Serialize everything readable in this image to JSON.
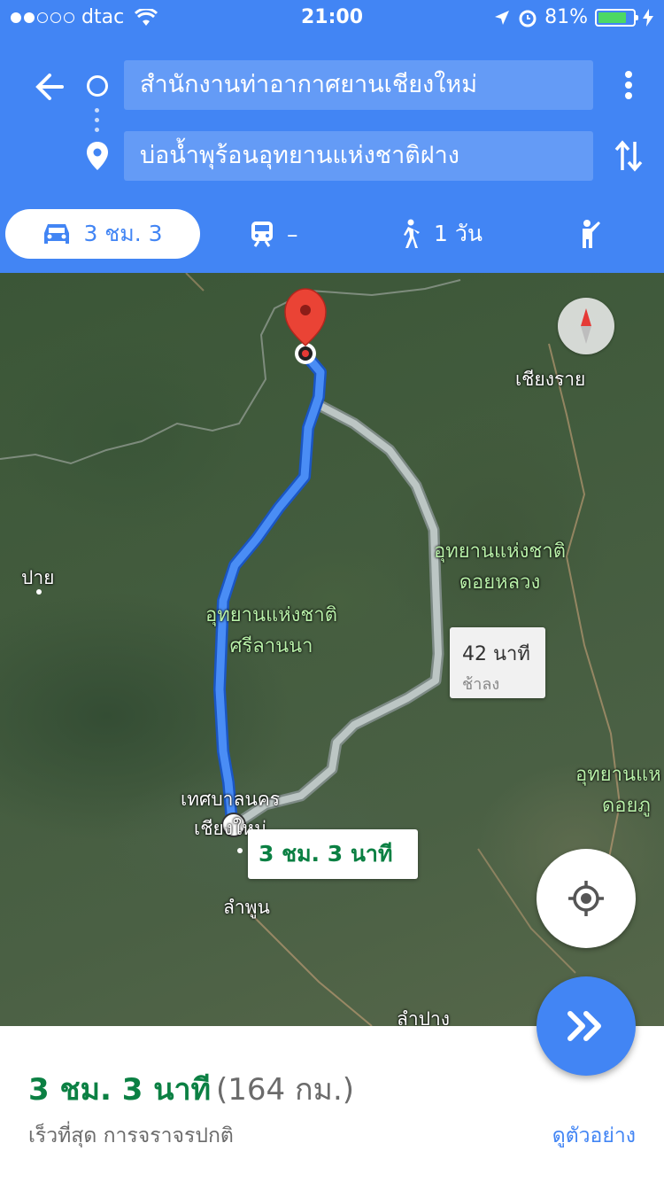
{
  "status_bar": {
    "carrier": "dtac",
    "time": "21:00",
    "battery": "81%",
    "battery_level": 0.81
  },
  "directions": {
    "origin": "สำนักงานท่าอากาศยานเชียงใหม่",
    "destination": "บ่อน้ำพุร้อนอุทยานแห่งชาติฝาง"
  },
  "travel_modes": [
    {
      "id": "drive",
      "label": "3 ชม. 3",
      "icon": "car-icon",
      "active": true
    },
    {
      "id": "transit",
      "label": "–",
      "icon": "train-icon",
      "active": false
    },
    {
      "id": "walk",
      "label": "1 วัน",
      "icon": "walking-icon",
      "active": false
    },
    {
      "id": "ride",
      "label": "",
      "icon": "hail-ride-icon",
      "active": false
    }
  ],
  "map": {
    "labels": {
      "chiang_rai": "เชียงราย",
      "pai": "ปาย",
      "doi_luang_1": "อุทยานแห่งชาติ",
      "doi_luang_2": "ดอยหลวง",
      "sri_lanna_1": "อุทยานแห่งชาติ",
      "sri_lanna_2": "ศรีลานนา",
      "chiang_mai_1": "เทศบาลนคร",
      "chiang_mai_2": "เชียงใหม่",
      "lamphun": "ลำพูน",
      "lampang": "ลำปาง",
      "doi_phu_1": "อุทยานแห",
      "doi_phu_2": "ดอยภู"
    },
    "alt_route": {
      "time": "42 นาที",
      "note": "ช้าลง"
    },
    "main_route": {
      "time": "3 ชม. 3 นาที"
    },
    "route_color": "#4285f4",
    "alt_route_color": "#bdc3c7"
  },
  "summary": {
    "duration": "3 ชม. 3 นาที",
    "distance": "(164 กม.)",
    "description": "เร็วที่สุด การจราจรปกติ",
    "preview": "ดูตัวอย่าง"
  },
  "colors": {
    "header": "#4285f4",
    "duration_green": "#0b8043"
  }
}
